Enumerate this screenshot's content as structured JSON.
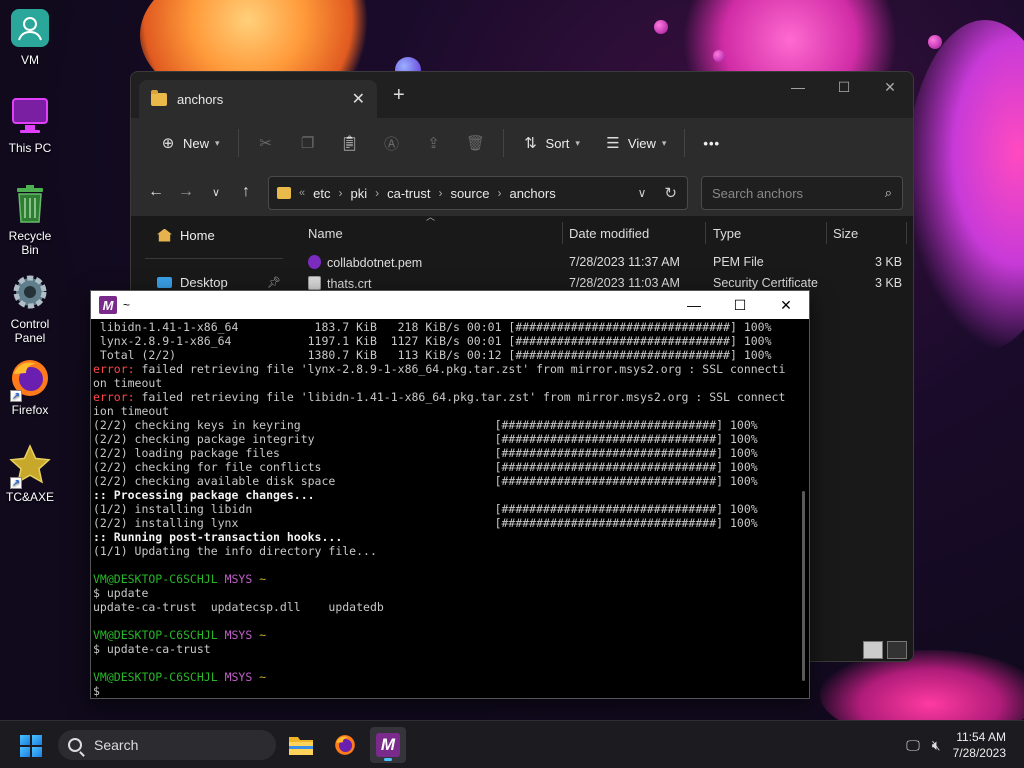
{
  "desktop": {
    "icons": [
      {
        "label": "VM",
        "icon": "user-folder-icon"
      },
      {
        "label": "This PC",
        "icon": "monitor-icon"
      },
      {
        "label": "Recycle Bin",
        "icon": "recycle-bin-icon"
      },
      {
        "label": "Control Panel",
        "icon": "gear-icon"
      },
      {
        "label": "Firefox",
        "icon": "firefox-icon"
      },
      {
        "label": "TC&AXE",
        "icon": "star-icon"
      }
    ]
  },
  "explorer": {
    "tab_title": "anchors",
    "toolbar": {
      "new_label": "New",
      "sort_label": "Sort",
      "view_label": "View",
      "more_label": "•••"
    },
    "breadcrumb": [
      "etc",
      "pki",
      "ca-trust",
      "source",
      "anchors"
    ],
    "search_placeholder": "Search anchors",
    "nav": [
      {
        "label": "Home",
        "icon": "home-icon"
      },
      {
        "label": "Desktop",
        "icon": "desktop-icon"
      }
    ],
    "columns": [
      "Name",
      "Date modified",
      "Type",
      "Size"
    ],
    "files": [
      {
        "name": "collabdotnet.pem",
        "date": "7/28/2023 11:37 AM",
        "type": "PEM File",
        "size": "3 KB",
        "icon": "pem-file-icon"
      },
      {
        "name": "thats.crt",
        "date": "7/28/2023 11:03 AM",
        "type": "Security Certificate",
        "size": "3 KB",
        "icon": "certificate-icon"
      }
    ]
  },
  "terminal": {
    "title": "~",
    "lines": [
      {
        "c": "",
        "t": " libidn-1.41-1-x86_64           183.7 KiB   218 KiB/s 00:01 [###############################] 100%"
      },
      {
        "c": "",
        "t": " lynx-2.8.9-1-x86_64           1197.1 KiB  1127 KiB/s 00:01 [###############################] 100%"
      },
      {
        "c": "",
        "t": " Total (2/2)                   1380.7 KiB   113 KiB/s 00:12 [###############################] 100%"
      },
      {
        "c": "err",
        "pre": "error:",
        "t": " failed retrieving file 'lynx-2.8.9-1-x86_64.pkg.tar.zst' from mirror.msys2.org : SSL connecti"
      },
      {
        "c": "",
        "t": "on timeout"
      },
      {
        "c": "err",
        "pre": "error:",
        "t": " failed retrieving file 'libidn-1.41-1-x86_64.pkg.tar.zst' from mirror.msys2.org : SSL connect"
      },
      {
        "c": "",
        "t": "ion timeout"
      },
      {
        "c": "",
        "t": "(2/2) checking keys in keyring                            [###############################] 100%"
      },
      {
        "c": "",
        "t": "(2/2) checking package integrity                          [###############################] 100%"
      },
      {
        "c": "",
        "t": "(2/2) loading package files                               [###############################] 100%"
      },
      {
        "c": "",
        "t": "(2/2) checking for file conflicts                         [###############################] 100%"
      },
      {
        "c": "",
        "t": "(2/2) checking available disk space                       [###############################] 100%"
      },
      {
        "c": "bold",
        "t": ":: Processing package changes..."
      },
      {
        "c": "",
        "t": "(1/2) installing libidn                                   [###############################] 100%"
      },
      {
        "c": "",
        "t": "(2/2) installing lynx                                     [###############################] 100%"
      },
      {
        "c": "bold",
        "t": ":: Running post-transaction hooks..."
      },
      {
        "c": "",
        "t": "(1/1) Updating the info directory file..."
      },
      {
        "c": "",
        "t": ""
      },
      {
        "c": "prompt",
        "user": "VM@DESKTOP-C6SCHJL",
        "sys": "MSYS",
        "dir": "~"
      },
      {
        "c": "",
        "t": "$ update"
      },
      {
        "c": "",
        "t": "update-ca-trust  updatecsp.dll    updatedb"
      },
      {
        "c": "",
        "t": ""
      },
      {
        "c": "prompt",
        "user": "VM@DESKTOP-C6SCHJL",
        "sys": "MSYS",
        "dir": "~"
      },
      {
        "c": "",
        "t": "$ update-ca-trust"
      },
      {
        "c": "",
        "t": ""
      },
      {
        "c": "prompt",
        "user": "VM@DESKTOP-C6SCHJL",
        "sys": "MSYS",
        "dir": "~"
      },
      {
        "c": "",
        "t": "$"
      }
    ]
  },
  "taskbar": {
    "search_label": "Search",
    "time": "11:54 AM",
    "date": "7/28/2023"
  }
}
